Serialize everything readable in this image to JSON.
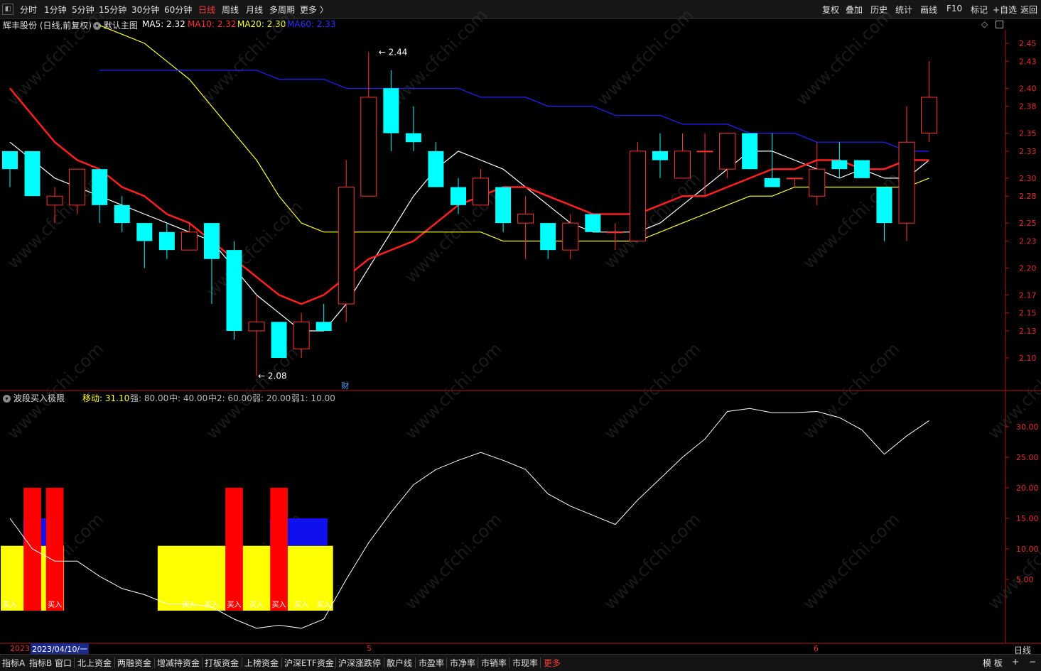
{
  "toolbar": {
    "menu_icon": "menu-icon",
    "periods": [
      "分时",
      "1分钟",
      "5分钟",
      "15分钟",
      "30分钟",
      "60分钟",
      "日线",
      "周线",
      "月线",
      "多周期",
      "更多 〉"
    ],
    "active_period": "日线",
    "actions": [
      "复权",
      "叠加",
      "历史",
      "统计",
      "画线",
      "F10",
      "标记",
      "+自选",
      "返回"
    ]
  },
  "main_header": {
    "stock": "辉丰股份 (日线,前复权)",
    "template": "默认主图",
    "ma5": "MA5: 2.32",
    "ma10": "MA10: 2.32",
    "ma20": "MA20: 2.30",
    "ma60": "MA60: 2.33",
    "colors": {
      "ma5": "#ffffff",
      "ma10": "#ff2020",
      "ma20": "#ffff33",
      "ma60": "#2222ff"
    }
  },
  "sub_header": {
    "name": "波段买入极限",
    "move": "移动: 31.10",
    "strong": "强: 80.00",
    "mid": "中: 40.00",
    "mid2": "中2: 60.00",
    "weak": "弱: 20.00",
    "weak1": "弱1: 10.00"
  },
  "price_axis": [
    "2.45",
    "2.43",
    "2.40",
    "2.38",
    "2.35",
    "2.33",
    "2.30",
    "2.28",
    "2.25",
    "2.23",
    "2.20",
    "2.17",
    "2.15",
    "2.13",
    "2.10"
  ],
  "sub_axis": [
    "30.00",
    "25.00",
    "20.00",
    "15.00",
    "10.00",
    "5.00"
  ],
  "annotations": {
    "high": "2.44",
    "low": "2.08",
    "fin_marker": "财",
    "buy_label": "买入"
  },
  "chart_data": {
    "type": "candlestick",
    "ylim": [
      2.07,
      2.47
    ],
    "candles": [
      {
        "o": 2.33,
        "h": 2.33,
        "l": 2.29,
        "c": 2.31
      },
      {
        "o": 2.33,
        "h": 2.33,
        "l": 2.28,
        "c": 2.28
      },
      {
        "o": 2.27,
        "h": 2.29,
        "l": 2.25,
        "c": 2.28
      },
      {
        "o": 2.27,
        "h": 2.31,
        "l": 2.26,
        "c": 2.31
      },
      {
        "o": 2.31,
        "h": 2.31,
        "l": 2.25,
        "c": 2.27
      },
      {
        "o": 2.27,
        "h": 2.28,
        "l": 2.24,
        "c": 2.25
      },
      {
        "o": 2.25,
        "h": 2.25,
        "l": 2.2,
        "c": 2.23
      },
      {
        "o": 2.24,
        "h": 2.25,
        "l": 2.21,
        "c": 2.22
      },
      {
        "o": 2.22,
        "h": 2.25,
        "l": 2.22,
        "c": 2.24
      },
      {
        "o": 2.25,
        "h": 2.25,
        "l": 2.16,
        "c": 2.21
      },
      {
        "o": 2.22,
        "h": 2.23,
        "l": 2.12,
        "c": 2.13
      },
      {
        "o": 2.13,
        "h": 2.17,
        "l": 2.08,
        "c": 2.14
      },
      {
        "o": 2.14,
        "h": 2.14,
        "l": 2.1,
        "c": 2.1
      },
      {
        "o": 2.11,
        "h": 2.15,
        "l": 2.1,
        "c": 2.14
      },
      {
        "o": 2.14,
        "h": 2.16,
        "l": 2.13,
        "c": 2.13
      },
      {
        "o": 2.16,
        "h": 2.32,
        "l": 2.14,
        "c": 2.29
      },
      {
        "o": 2.28,
        "h": 2.44,
        "l": 2.28,
        "c": 2.39
      },
      {
        "o": 2.4,
        "h": 2.42,
        "l": 2.33,
        "c": 2.35
      },
      {
        "o": 2.35,
        "h": 2.38,
        "l": 2.33,
        "c": 2.34
      },
      {
        "o": 2.33,
        "h": 2.34,
        "l": 2.29,
        "c": 2.29
      },
      {
        "o": 2.29,
        "h": 2.3,
        "l": 2.26,
        "c": 2.27
      },
      {
        "o": 2.27,
        "h": 2.31,
        "l": 2.27,
        "c": 2.3
      },
      {
        "o": 2.29,
        "h": 2.29,
        "l": 2.24,
        "c": 2.25
      },
      {
        "o": 2.25,
        "h": 2.28,
        "l": 2.21,
        "c": 2.26
      },
      {
        "o": 2.25,
        "h": 2.25,
        "l": 2.21,
        "c": 2.22
      },
      {
        "o": 2.22,
        "h": 2.26,
        "l": 2.21,
        "c": 2.25
      },
      {
        "o": 2.26,
        "h": 2.26,
        "l": 2.24,
        "c": 2.24
      },
      {
        "o": 2.24,
        "h": 2.25,
        "l": 2.22,
        "c": 2.24
      },
      {
        "o": 2.23,
        "h": 2.34,
        "l": 2.23,
        "c": 2.33
      },
      {
        "o": 2.33,
        "h": 2.35,
        "l": 2.3,
        "c": 2.32
      },
      {
        "o": 2.3,
        "h": 2.35,
        "l": 2.3,
        "c": 2.33
      },
      {
        "o": 2.33,
        "h": 2.35,
        "l": 2.28,
        "c": 2.33
      },
      {
        "o": 2.31,
        "h": 2.35,
        "l": 2.3,
        "c": 2.35
      },
      {
        "o": 2.35,
        "h": 2.35,
        "l": 2.31,
        "c": 2.31
      },
      {
        "o": 2.3,
        "h": 2.35,
        "l": 2.29,
        "c": 2.29
      },
      {
        "o": 2.3,
        "h": 2.3,
        "l": 2.29,
        "c": 2.3
      },
      {
        "o": 2.28,
        "h": 2.34,
        "l": 2.27,
        "c": 2.31
      },
      {
        "o": 2.32,
        "h": 2.34,
        "l": 2.3,
        "c": 2.31
      },
      {
        "o": 2.32,
        "h": 2.32,
        "l": 2.3,
        "c": 2.3
      },
      {
        "o": 2.29,
        "h": 2.29,
        "l": 2.23,
        "c": 2.25
      },
      {
        "o": 2.25,
        "h": 2.38,
        "l": 2.23,
        "c": 2.34
      },
      {
        "o": 2.35,
        "h": 2.43,
        "l": 2.34,
        "c": 2.39
      }
    ],
    "ma_lines": [
      {
        "name": "MA5",
        "color": "#ffffff",
        "points": [
          2.34,
          2.32,
          2.3,
          2.29,
          2.28,
          2.27,
          2.26,
          2.25,
          2.24,
          2.23,
          2.2,
          2.17,
          2.15,
          2.13,
          2.13,
          2.16,
          2.2,
          2.24,
          2.28,
          2.31,
          2.33,
          2.32,
          2.31,
          2.29,
          2.27,
          2.25,
          2.24,
          2.24,
          2.24,
          2.25,
          2.27,
          2.29,
          2.31,
          2.33,
          2.33,
          2.32,
          2.31,
          2.3,
          2.31,
          2.3,
          2.3,
          2.32
        ]
      },
      {
        "name": "MA10",
        "color": "#ff2020",
        "points": [
          2.4,
          2.37,
          2.34,
          2.32,
          2.31,
          2.29,
          2.28,
          2.26,
          2.25,
          2.23,
          2.21,
          2.19,
          2.17,
          2.16,
          2.17,
          2.19,
          2.21,
          2.22,
          2.23,
          2.25,
          2.27,
          2.28,
          2.29,
          2.29,
          2.28,
          2.27,
          2.26,
          2.26,
          2.26,
          2.27,
          2.28,
          2.28,
          2.29,
          2.3,
          2.31,
          2.31,
          2.32,
          2.32,
          2.31,
          2.31,
          2.32,
          2.32
        ]
      },
      {
        "name": "MA20",
        "color": "#ffff33",
        "points": [
          2.47,
          2.46,
          2.45,
          2.43,
          2.41,
          2.38,
          2.35,
          2.32,
          2.28,
          2.25,
          2.24,
          2.24,
          2.24,
          2.24,
          2.24,
          2.24,
          2.24,
          2.24,
          2.23,
          2.23,
          2.23,
          2.23,
          2.23,
          2.23,
          2.23,
          2.24,
          2.25,
          2.26,
          2.27,
          2.28,
          2.28,
          2.29,
          2.29,
          2.29,
          2.29,
          2.29,
          2.29,
          2.3
        ]
      },
      {
        "name": "MA60",
        "color": "#2222ff",
        "points": [
          2.42,
          2.42,
          2.42,
          2.42,
          2.42,
          2.42,
          2.42,
          2.42,
          2.41,
          2.41,
          2.41,
          2.4,
          2.4,
          2.4,
          2.4,
          2.4,
          2.4,
          2.39,
          2.39,
          2.39,
          2.38,
          2.38,
          2.38,
          2.37,
          2.37,
          2.37,
          2.36,
          2.36,
          2.36,
          2.35,
          2.35,
          2.35,
          2.34,
          2.34,
          2.34,
          2.34,
          2.33,
          2.33
        ]
      }
    ],
    "sub_chart": {
      "ylim": [
        0,
        35
      ],
      "line": [
        15.0,
        10.0,
        8.0,
        8.0,
        5.5,
        3.5,
        2.5,
        1.0,
        1.0,
        0.5,
        -1.5,
        -3.0,
        -2.5,
        -3.0,
        -1.5,
        5.0,
        11.0,
        16.0,
        20.5,
        23.0,
        24.5,
        25.8,
        24.5,
        23.0,
        19.0,
        17.0,
        15.5,
        14.0,
        18.0,
        21.5,
        25.0,
        28.0,
        32.5,
        33.0,
        32.3,
        32.3,
        32.5,
        31.5,
        29.5,
        25.5,
        28.5,
        31.0
      ],
      "yellow_blocks": [
        {
          "from": 0,
          "to": 2,
          "top": 10.5
        },
        {
          "from": 7,
          "to": 14,
          "top": 10.5
        }
      ],
      "blue_blocks": [
        {
          "from": 1,
          "to": 2,
          "top": 15.0,
          "bottom": 10.5
        },
        {
          "from": 12,
          "to": 14,
          "top": 15.0,
          "bottom": 10.5
        }
      ],
      "red_bars": [
        1,
        2,
        10,
        12
      ],
      "red_top": 20.0,
      "buy_label_at": [
        0,
        2,
        8,
        9,
        10,
        11,
        12,
        13,
        14
      ]
    }
  },
  "date_bar": {
    "start": "2023",
    "date": "2023/04/10/一",
    "month5": "5",
    "month6": "6",
    "period": "日线"
  },
  "bottom_tabs": [
    "指标A",
    "指标B",
    "窗口",
    "北上资金",
    "两融资金",
    "增减持资金",
    "打板资金",
    "上榜资金",
    "沪深ETF资金",
    "沪深涨跌停",
    "散户线",
    "市盈率",
    "市净率",
    "市销率",
    "市现率",
    "更多"
  ],
  "bottom_right": [
    "模 板",
    "+",
    "−"
  ],
  "watermark": "www.cfchi.com"
}
